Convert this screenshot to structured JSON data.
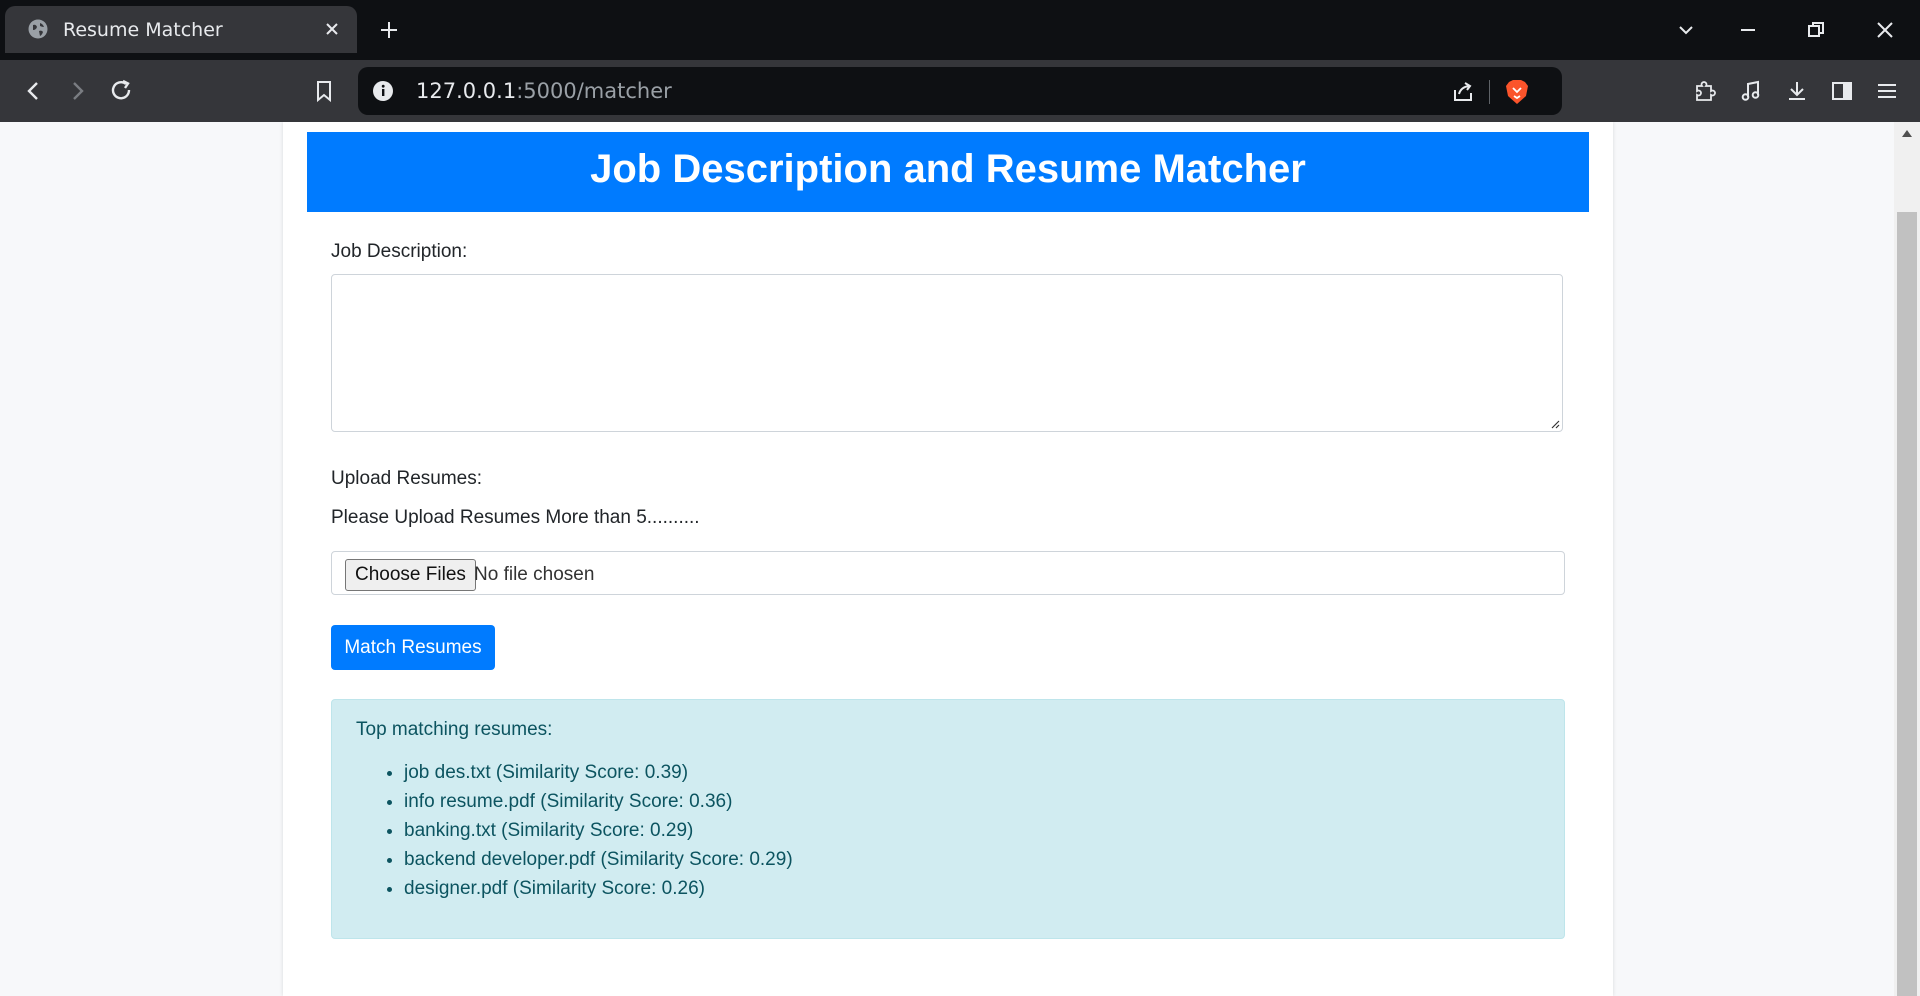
{
  "browser": {
    "tab_title": "Resume Matcher",
    "url_host": "127.0.0.1",
    "url_rest": ":5000/matcher"
  },
  "page": {
    "heading": "Job Description and Resume Matcher",
    "job_description_label": "Job Description:",
    "job_description_value": "",
    "upload_label": "Upload Resumes:",
    "upload_note": "Please Upload Resumes More than 5..........",
    "choose_files_label": "Choose Files",
    "no_file_text": "No file chosen",
    "match_button_label": "Match Resumes",
    "results_heading": "Top matching resumes:",
    "results": [
      "job des.txt (Similarity Score: 0.39)",
      "info resume.pdf (Similarity Score: 0.36)",
      "banking.txt (Similarity Score: 0.29)",
      "backend developer.pdf (Similarity Score: 0.29)",
      "designer.pdf (Similarity Score: 0.26)"
    ]
  },
  "colors": {
    "primary": "#007bff",
    "info_bg": "#d1ecf1",
    "info_text": "#0c5460",
    "chrome_dark": "#0e1013",
    "chrome_toolbar": "#35363a"
  },
  "icons": {
    "tab_favicon": "globe-icon",
    "tab_close": "close-icon",
    "new_tab": "plus-icon",
    "back": "back-arrow-icon",
    "forward": "forward-arrow-icon",
    "reload": "reload-icon",
    "bookmark": "bookmark-icon",
    "site_info": "info-icon",
    "share": "share-icon",
    "brave_shield": "brave-lion-icon",
    "extensions": "puzzle-icon",
    "media": "music-note-icon",
    "downloads": "download-icon",
    "sidebar": "sidebar-icon",
    "menu": "hamburger-menu-icon"
  }
}
